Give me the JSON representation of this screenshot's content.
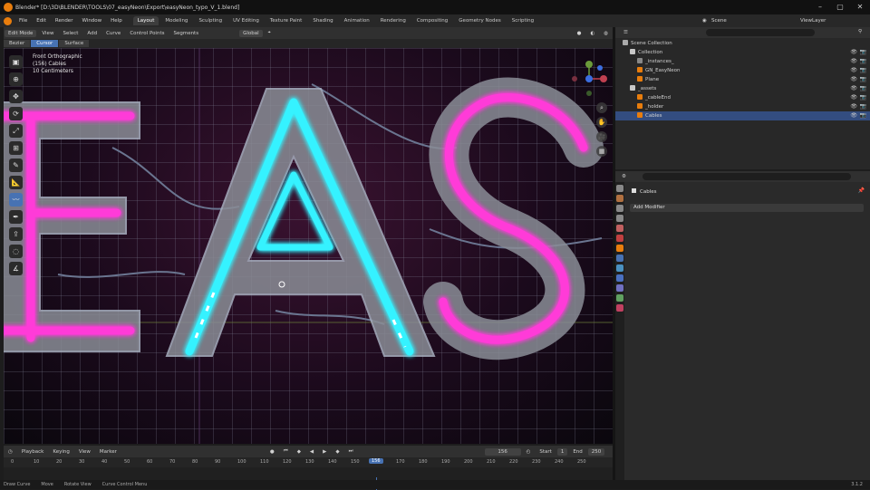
{
  "window": {
    "title": "Blender* [D:\\3D\\BLENDER\\TOOLS\\07_easyNeon\\Export\\easyNeon_typo_V_1.blend]"
  },
  "menu": [
    "File",
    "Edit",
    "Render",
    "Window",
    "Help"
  ],
  "workspaces": [
    "Layout",
    "Modeling",
    "Sculpting",
    "UV Editing",
    "Texture Paint",
    "Shading",
    "Animation",
    "Rendering",
    "Compositing",
    "Geometry Nodes",
    "Scripting"
  ],
  "active_workspace": "Layout",
  "scene": {
    "label": "Scene",
    "view_layer": "ViewLayer"
  },
  "viewport_header": {
    "mode": "Edit Mode",
    "menus": [
      "View",
      "Select",
      "Add",
      "Curve",
      "Control Points",
      "Segments"
    ],
    "transform": "Global"
  },
  "curve_header": {
    "type": "Bezier",
    "items": [
      "Cursor",
      "Surface"
    ]
  },
  "viewport_info": {
    "line1": "Front Orthographic",
    "line2": "(156) Cables",
    "line3": "10 Centimeters"
  },
  "letters": [
    "E",
    "A",
    "S"
  ],
  "timeline": {
    "menus": [
      "Playback",
      "Keying",
      "View",
      "Marker"
    ],
    "current_frame": "156",
    "start_label": "Start",
    "start": "1",
    "end_label": "End",
    "end": "250"
  },
  "ruler_ticks": [
    "0",
    "10",
    "20",
    "30",
    "40",
    "50",
    "60",
    "70",
    "80",
    "90",
    "100",
    "110",
    "120",
    "130",
    "140",
    "150",
    "160",
    "170",
    "180",
    "190",
    "200",
    "210",
    "220",
    "230",
    "240",
    "250"
  ],
  "statusbar": [
    "Draw Curve",
    "Move",
    "Rotate View",
    "Curve Control Menu"
  ],
  "version": "3.1.2",
  "outliner": {
    "title": "Scene Collection",
    "rows": [
      {
        "label": "Collection",
        "depth": 1,
        "color": "#c8c8c8",
        "selected": false
      },
      {
        "label": "_instances_",
        "depth": 2,
        "color": "#888888",
        "selected": false
      },
      {
        "label": "GN_EasyNeon",
        "depth": 2,
        "color": "#e87d0d",
        "selected": false
      },
      {
        "label": "Plane",
        "depth": 2,
        "color": "#e87d0d",
        "selected": false
      },
      {
        "label": "_assets",
        "depth": 1,
        "color": "#c8c8c8",
        "selected": false
      },
      {
        "label": "_cableEnd",
        "depth": 2,
        "color": "#e87d0d",
        "selected": false
      },
      {
        "label": "_holder",
        "depth": 2,
        "color": "#e87d0d",
        "selected": false
      },
      {
        "label": "Cables",
        "depth": 2,
        "color": "#e87d0d",
        "selected": true
      }
    ]
  },
  "properties": {
    "object": "Cables",
    "add_modifier": "Add Modifier"
  },
  "colors": {
    "pink": "#ff3ad8",
    "cyan": "#35f2ff",
    "accent": "#4772b3"
  }
}
